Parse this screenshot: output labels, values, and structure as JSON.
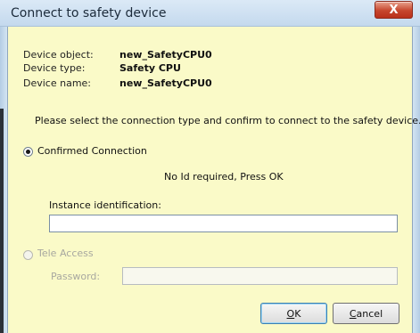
{
  "window": {
    "title": "Connect to safety device",
    "close_glyph": "X"
  },
  "device_info": [
    {
      "label": "Device object:",
      "value": "new_SafetyCPU0"
    },
    {
      "label": "Device type:",
      "value": "Safety CPU"
    },
    {
      "label": "Device name:",
      "value": "new_SafetyCPU0"
    }
  ],
  "instruction": "Please select the connection type and confirm to connect to the safety device.",
  "confirmed_connection": {
    "label": "Confirmed Connection",
    "selected": true,
    "no_id_text": "No Id required, Press OK",
    "instance_label": "Instance identification:",
    "instance_value": ""
  },
  "tele_access": {
    "label": "Tele Access",
    "selected": false,
    "enabled": false,
    "password_label": "Password:",
    "password_value": ""
  },
  "buttons": {
    "ok": {
      "mnemonic": "O",
      "rest": "K"
    },
    "cancel": {
      "mnemonic": "C",
      "rest": "ancel"
    }
  },
  "colors": {
    "client_background": "#fafac8",
    "close_button": "#c6462d"
  }
}
